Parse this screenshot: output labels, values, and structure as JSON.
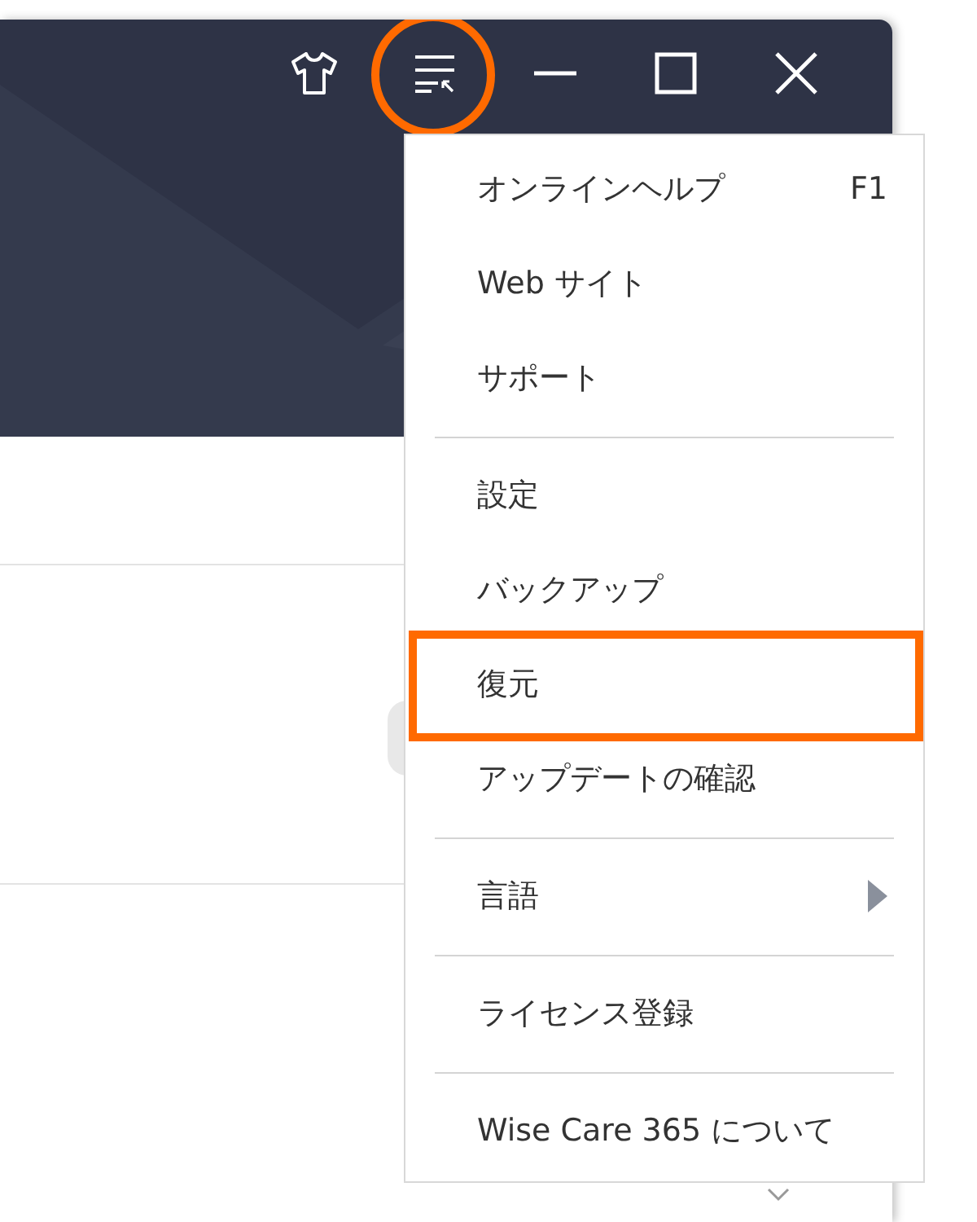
{
  "title_bar": {
    "buttons": [
      {
        "kind": "skin",
        "circled": false
      },
      {
        "kind": "menu",
        "circled": true
      },
      {
        "kind": "minimize",
        "circled": false
      },
      {
        "kind": "maximize",
        "circled": false
      },
      {
        "kind": "close",
        "circled": false
      }
    ]
  },
  "menu": {
    "items": [
      {
        "kind": "item",
        "label": "オンラインヘルプ",
        "shortcut": "F1",
        "submenu": false,
        "highlighted": false
      },
      {
        "kind": "item",
        "label": "Web サイト",
        "submenu": false,
        "highlighted": false
      },
      {
        "kind": "item",
        "label": "サポート",
        "submenu": false,
        "highlighted": false
      },
      {
        "kind": "divider"
      },
      {
        "kind": "item",
        "label": "設定",
        "submenu": false,
        "highlighted": false
      },
      {
        "kind": "item",
        "label": "バックアップ",
        "submenu": false,
        "highlighted": false
      },
      {
        "kind": "item",
        "label": "復元",
        "submenu": false,
        "highlighted": true
      },
      {
        "kind": "item",
        "label": "アップデートの確認",
        "submenu": false,
        "highlighted": false
      },
      {
        "kind": "divider"
      },
      {
        "kind": "item",
        "label": "言語",
        "submenu": true,
        "highlighted": false
      },
      {
        "kind": "divider"
      },
      {
        "kind": "item",
        "label": "ライセンス登録",
        "submenu": false,
        "highlighted": false
      },
      {
        "kind": "divider"
      },
      {
        "kind": "item",
        "label": "Wise Care 365 について",
        "submenu": false,
        "highlighted": false
      }
    ]
  }
}
